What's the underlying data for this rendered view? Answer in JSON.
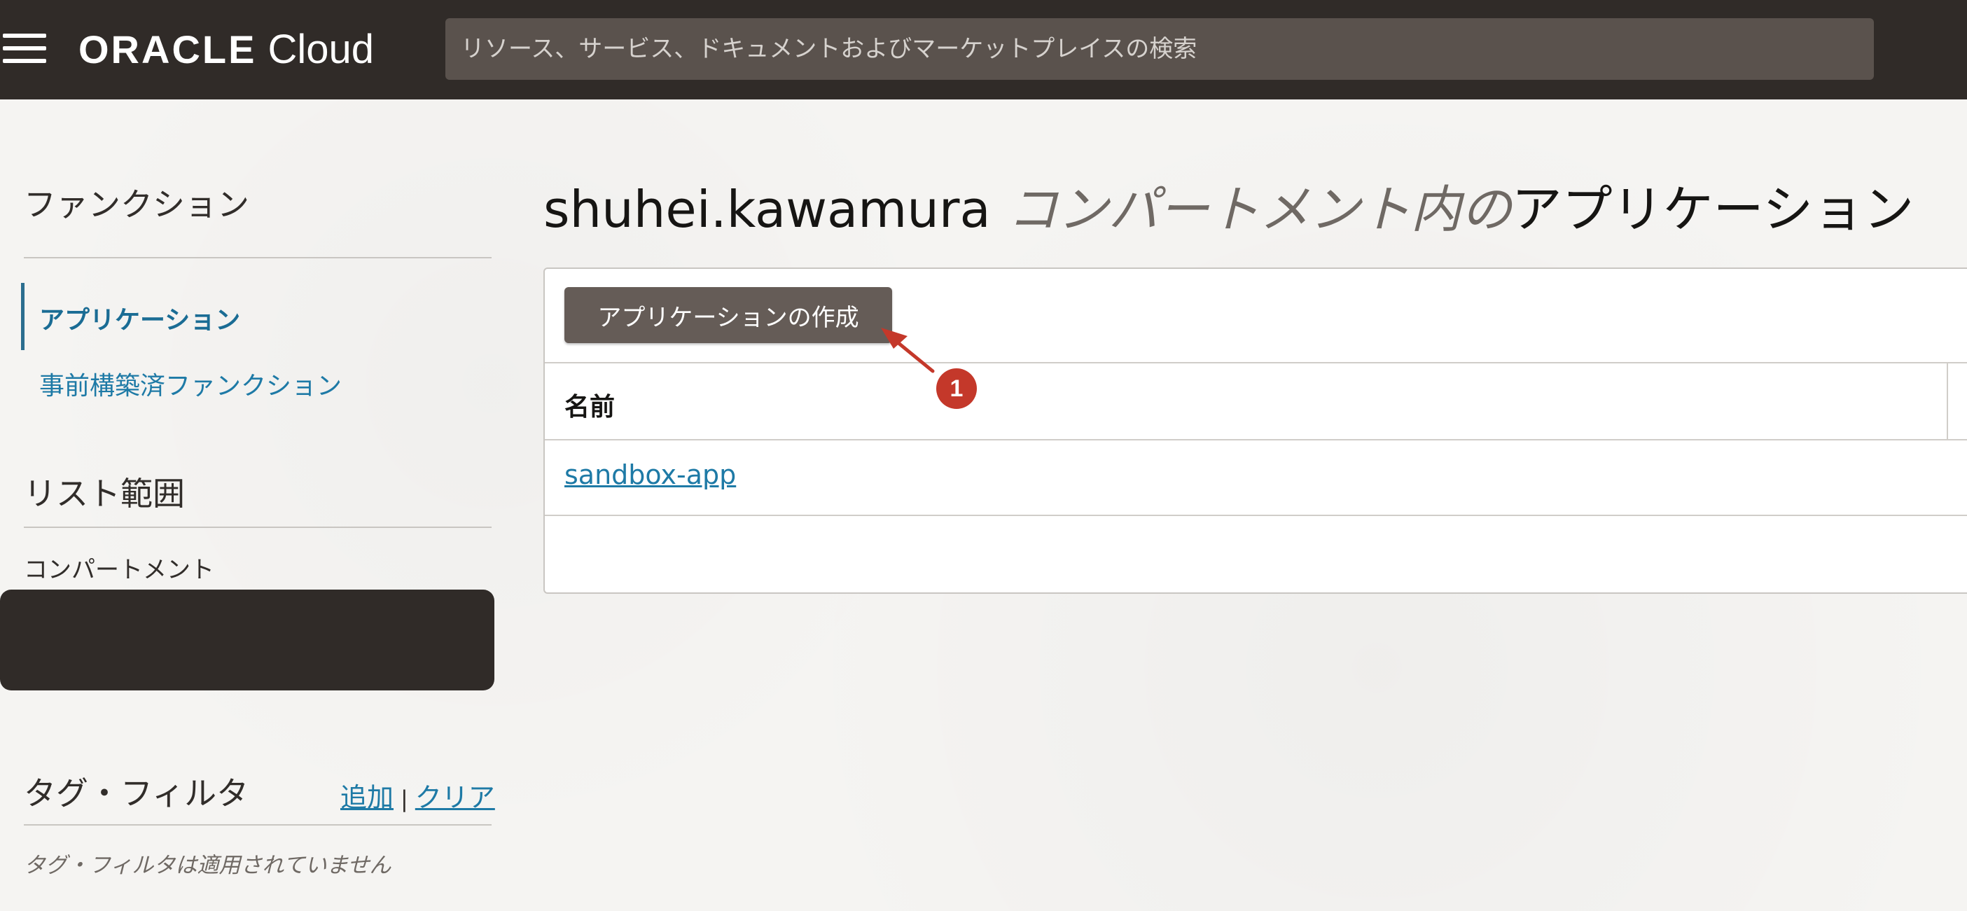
{
  "header": {
    "logo_oracle": "ORACLE",
    "logo_cloud": "Cloud",
    "search_placeholder": "リソース、サービス、ドキュメントおよびマーケットプレイスの検索"
  },
  "sidebar": {
    "section_title": "ファンクション",
    "nav_items": [
      {
        "label": "アプリケーション",
        "active": true
      },
      {
        "label": "事前構築済ファンクション",
        "active": false
      }
    ],
    "scope_title": "リスト範囲",
    "compartment_label": "コンパートメント",
    "tag_filter_title": "タグ・フィルタ",
    "tag_add": "追加",
    "tag_separator": "|",
    "tag_clear": "クリア",
    "tag_filter_note": "タグ・フィルタは適用されていません"
  },
  "main": {
    "title_compartment": "shuhei.kawamura",
    "title_middle": "コンパートメント内の",
    "title_suffix": "アプリケーション",
    "create_button": "アプリケーションの作成",
    "table": {
      "columns": [
        "名前"
      ],
      "rows": [
        {
          "name": "sandbox-app"
        }
      ]
    }
  },
  "annotation": {
    "callout_number": "1",
    "color": "#c4382a"
  },
  "colors": {
    "topbar": "#302b28",
    "link": "#1e7aa6",
    "button": "#655c57"
  }
}
